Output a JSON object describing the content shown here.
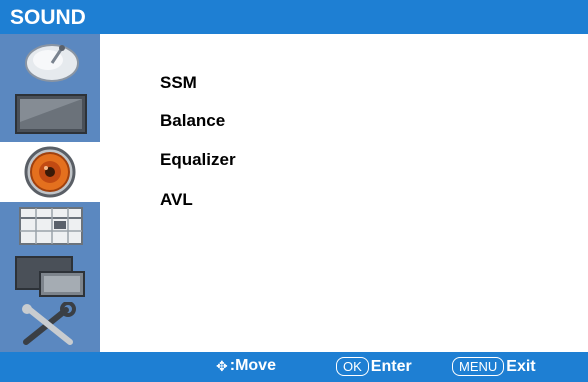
{
  "header": {
    "title": "SOUND"
  },
  "sidebar": {
    "items": [
      {
        "icon": "satellite-dish-icon"
      },
      {
        "icon": "picture-screen-icon"
      },
      {
        "icon": "speaker-icon",
        "selected": true
      },
      {
        "icon": "schedule-icon"
      },
      {
        "icon": "display-setup-icon"
      },
      {
        "icon": "tools-icon"
      }
    ]
  },
  "menu": {
    "items": [
      {
        "label": "SSM"
      },
      {
        "label": "Balance"
      },
      {
        "label": "Equalizer"
      },
      {
        "label": "AVL"
      }
    ]
  },
  "footer": {
    "move_label": ":Move",
    "ok_key": "OK",
    "enter_label": "Enter",
    "menu_key": "MENU",
    "exit_label": "Exit"
  },
  "colors": {
    "header_bg": "#1e7fd3",
    "sidebar_bg": "#5b88c0",
    "accent_orange": "#e4701e"
  }
}
